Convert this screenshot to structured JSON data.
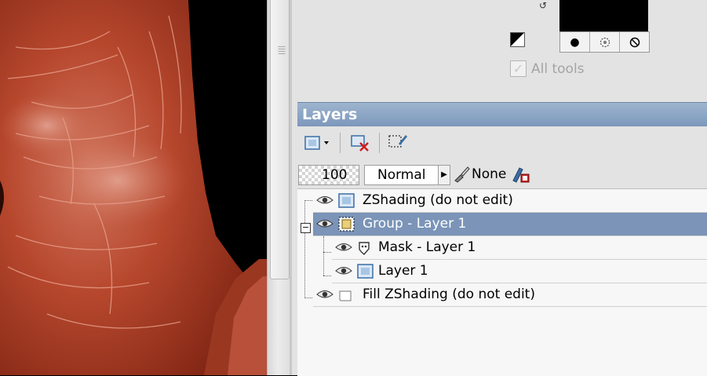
{
  "canvas": {},
  "top_section": {
    "all_tools_label": "All tools",
    "fill_buttons": [
      "solid-fill-icon",
      "gradient-fill-icon",
      "no-fill-icon"
    ]
  },
  "layers": {
    "title": "Layers",
    "opacity": "100",
    "blend_mode": "Normal",
    "link_mode": "None",
    "items": [
      {
        "name": "ZShading (do not edit)",
        "indent": 0,
        "selected": false,
        "icon": "raster-layer-icon"
      },
      {
        "name": "Group - Layer 1",
        "indent": 0,
        "selected": true,
        "icon": "group-layer-icon"
      },
      {
        "name": "Mask - Layer 1",
        "indent": 1,
        "selected": false,
        "icon": "mask-layer-icon"
      },
      {
        "name": "Layer 1",
        "indent": 1,
        "selected": false,
        "icon": "raster-layer-icon"
      },
      {
        "name": "Fill ZShading (do not edit)",
        "indent": 0,
        "selected": false,
        "icon": "fill-layer-icon"
      }
    ]
  },
  "colors": {
    "panel_bg": "#e3e3e3",
    "header_blue": "#7c98bb",
    "selected_row": "#7b94b8",
    "skin": "#b64a30"
  }
}
